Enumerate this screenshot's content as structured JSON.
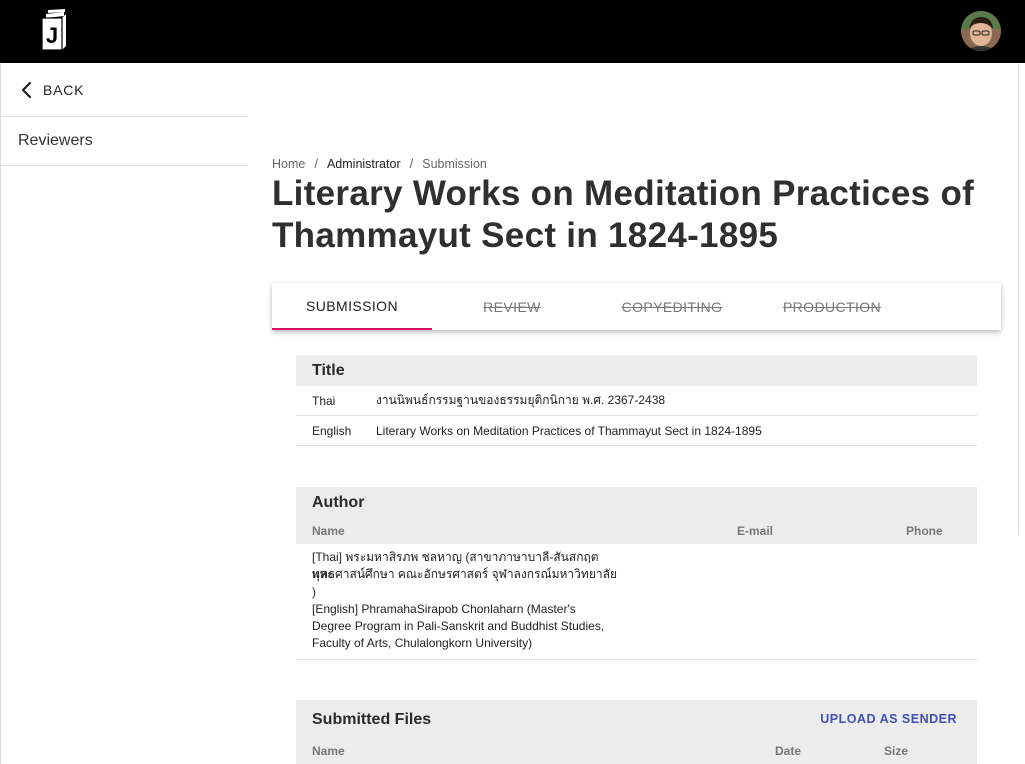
{
  "header": {
    "logo_letter": "J",
    "avatar_icon": "user-avatar"
  },
  "sidebar": {
    "back_label": "BACK",
    "items": [
      {
        "label": "Reviewers"
      }
    ]
  },
  "breadcrumb": {
    "items": [
      "Home",
      "Administrator",
      "Submission"
    ],
    "separator": "/"
  },
  "page": {
    "title": "Literary Works on Meditation Practices of Thammayut Sect in 1824-1895"
  },
  "tabs": [
    {
      "label": "SUBMISSION",
      "state": "active"
    },
    {
      "label": "REVIEW",
      "state": "disabled"
    },
    {
      "label": "COPYEDITING",
      "state": "disabled"
    },
    {
      "label": "PRODUCTION",
      "state": "disabled"
    }
  ],
  "title_section": {
    "heading": "Title",
    "rows": [
      {
        "label": "Thai",
        "value": "งานนิพนธ์กรรมฐานของธรรมยุติกนิกาย พ.ศ. 2367-2438"
      },
      {
        "label": "English",
        "value": "Literary Works on Meditation Practices of Thammayut Sect in 1824-1895"
      }
    ]
  },
  "author_section": {
    "heading": "Author",
    "columns": [
      "Name",
      "E-mail",
      "Phone"
    ],
    "lines": [
      "[Thai] พระมหาสิรภพ ชลหาญ (สาขาภาษาบาลี-สันสกฤต และ",
      "พุทธศาสน์ศึกษา คณะอักษรศาสตร์ จุฬาลงกรณ์มหาวิทยาลัย",
      ")",
      "[English] PhramahaSirapob Chonlaharn (Master's",
      "Degree Program in Pali-Sanskrit and Buddhist Studies,",
      "Faculty of Arts, Chulalongkorn University)"
    ]
  },
  "files_section": {
    "heading": "Submitted Files",
    "upload_label": "UPLOAD AS SENDER",
    "columns": [
      "Name",
      "Date",
      "Size"
    ]
  },
  "colors": {
    "topbar": "#000000",
    "accent_tab": "#e0125f",
    "link": "#3f51b5",
    "section_bg": "#ececec"
  }
}
